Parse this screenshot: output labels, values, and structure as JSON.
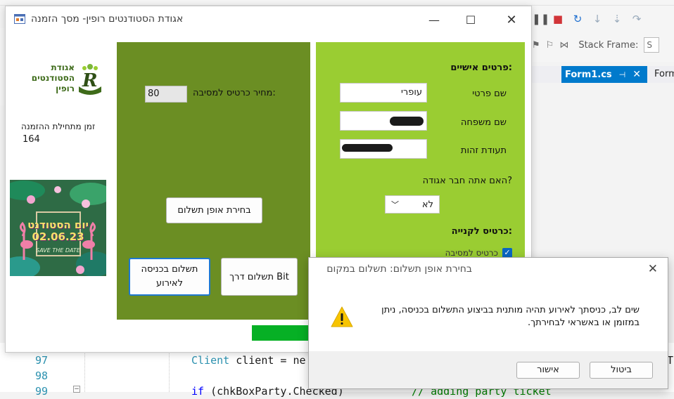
{
  "ide": {
    "stack_frame_label": "Stack Frame:",
    "stack_frame_value": "S",
    "tab_active": "Form1.cs",
    "tab_other": "Form",
    "code_lines": [
      {
        "number": "97",
        "text": "Client client = ne"
      },
      {
        "number": "98",
        "text": ""
      },
      {
        "number": "99",
        "text": "if (chkBoxParty.Checked)"
      }
    ],
    "comment_fragment": "// adding party ticket",
    "right_edge_char": "T"
  },
  "window": {
    "title": "אגודת הסטודנטים רופין- מסך הזמנה"
  },
  "left": {
    "logo_text_line1": "אגודת",
    "logo_text_line2": "הסטודנטים",
    "logo_text_line3": "רופין",
    "start_label": "זמן מתחילת ההזמנה",
    "start_value": "164",
    "poster_title_line1": "יום הסטודנט",
    "poster_date": "02.06.23",
    "poster_sub": "SAVE THE DATE"
  },
  "center": {
    "price_label": "מחיר כרטיס למסיבה:",
    "price_value": "80",
    "choose_payment": "בחירת אופן תשלום",
    "pay_bit": "תשלום דרך Bit",
    "pay_entry": "תשלום בכניסה לאירוע"
  },
  "right": {
    "personal_title": "פרטים אישיים:",
    "first_name_label": "שם פרטי",
    "first_name_value": "עופרי",
    "last_name_label": "שם משפחה",
    "id_label": "תעודת זהות",
    "member_question": "האם אתה חבר אגודה?",
    "member_value": "לא",
    "tickets_title": "כרטיס לקנייה:",
    "party_ticket_label": "כרטיס למסיבה"
  },
  "progress": {
    "fraction": 0.9
  },
  "dialog": {
    "title": "בחירת אופן תשלום: תשלום במקום",
    "message_line1": "שים לב, כניסתך לאירוע תהיה מותנית בביצוע התשלום בכניסה, ניתן",
    "message_line2": "במזומן או באשראי לבחירתך.",
    "ok_label": "אישור",
    "cancel_label": "ביטול"
  },
  "colors": {
    "center_panel": "#6b8e23",
    "right_panel": "#9acd32",
    "progress_fill": "#06b025",
    "accent": "#007acc"
  }
}
